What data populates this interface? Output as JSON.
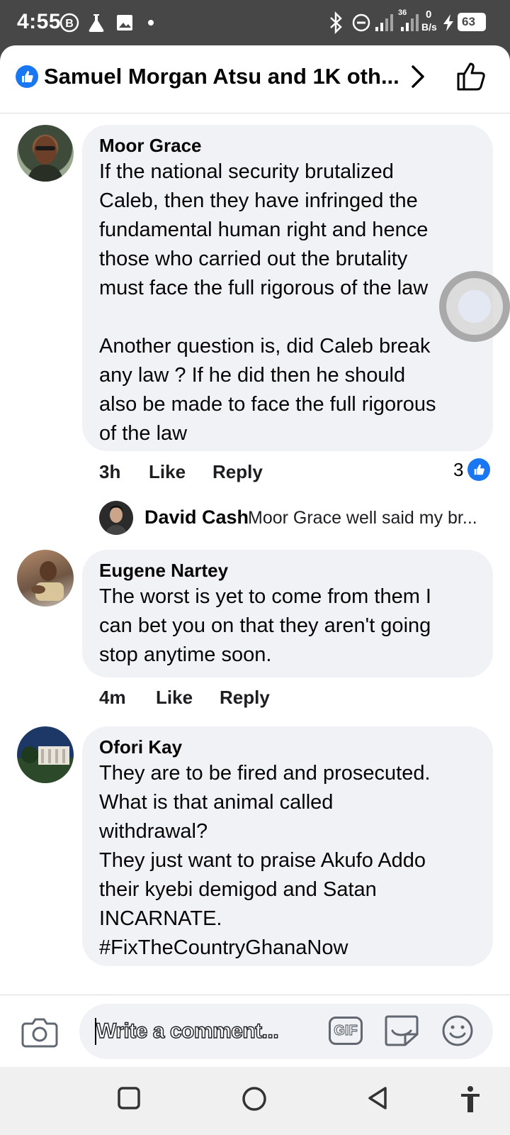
{
  "status_bar": {
    "time": "4:55",
    "network": "36",
    "speed_value": "0",
    "speed_unit": "B/s",
    "battery": "63"
  },
  "header": {
    "reactions_summary": "Samuel Morgan Atsu and 1K oth...",
    "icons": [
      "like-icon",
      "chevron-right-icon",
      "thumbs-up-outline-icon"
    ]
  },
  "comments": [
    {
      "author": "Moor Grace",
      "text": "If the national security brutalized\nCaleb, then they have infringed the\nfundamental human right and hence\nthose who carried out the brutality\nmust face the full rigorous of the law\n\nAnother question is, did Caleb break\nany law ? If he did then he should\nalso be made to face the full rigorous\nof the law",
      "time": "3h",
      "like_label": "Like",
      "reply_label": "Reply",
      "reaction_count": "3"
    },
    {
      "author": "Eugene Nartey",
      "text": "The worst is yet to come from them I\ncan bet you on that they aren't going\nstop anytime soon.",
      "time": "4m",
      "like_label": "Like",
      "reply_label": "Reply"
    },
    {
      "author": "Ofori Kay",
      "text": "They are to be fired and prosecuted.\nWhat is that animal called\nwithdrawal?\nThey just want to praise Akufo Addo\ntheir kyebi demigod and Satan\nINCARNATE.\n#FixTheCountryGhanaNow"
    }
  ],
  "reply_preview": {
    "author": "David Cash",
    "text": "Moor Grace  well said my br..."
  },
  "composer": {
    "placeholder": "Write a comment...",
    "gif_label": "GIF"
  },
  "colors": {
    "facebook_blue": "#1a77f2",
    "bubble_bg": "#f0f2f5",
    "status_bar_bg": "#474747"
  }
}
